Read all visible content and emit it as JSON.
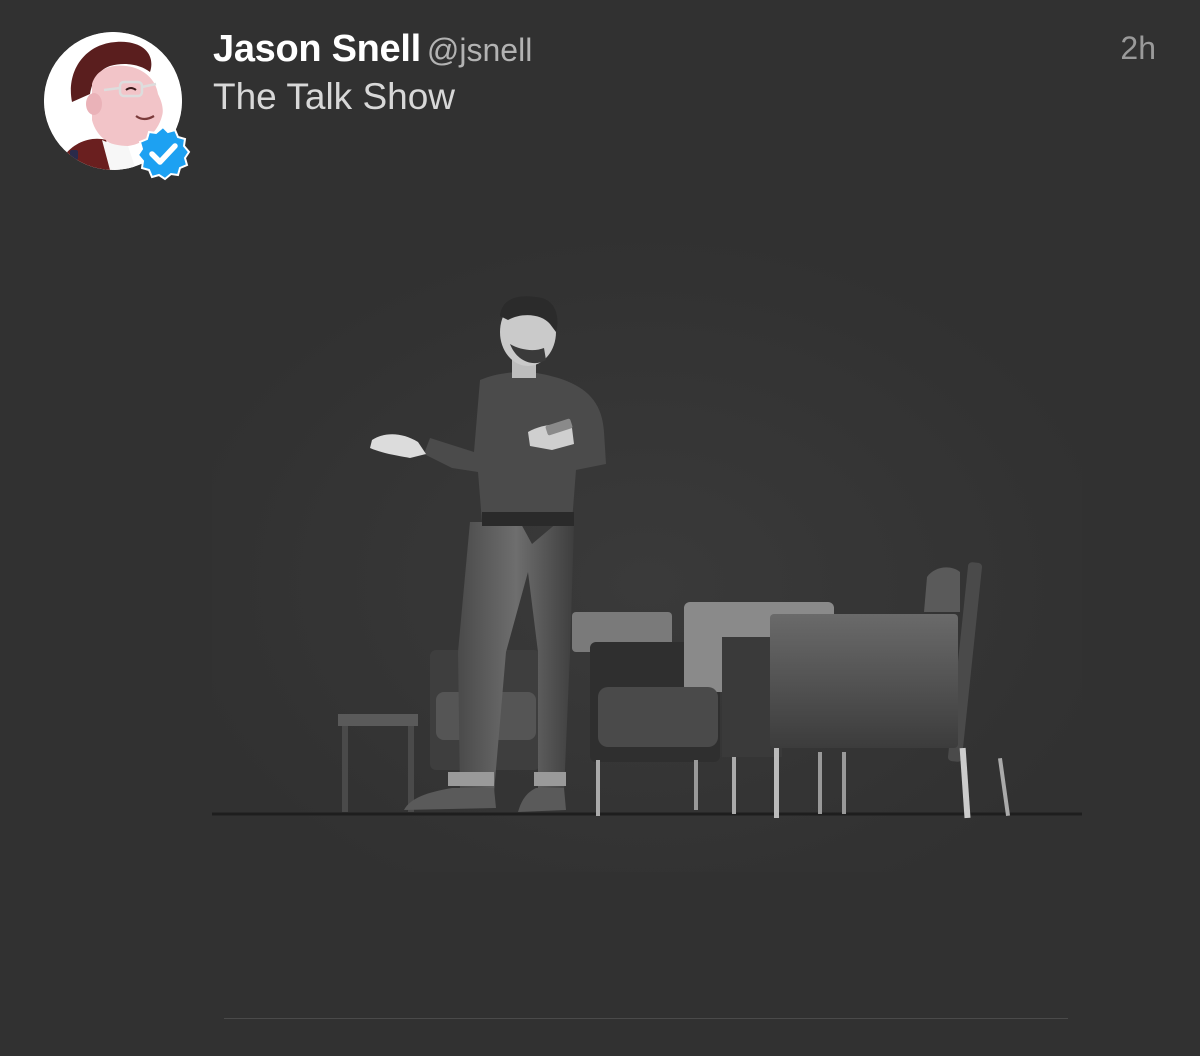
{
  "tweet": {
    "author": {
      "display_name": "Jason Snell",
      "handle": "@jsnell",
      "verified": true,
      "avatar_icon": "cartoon-avatar",
      "badge_icon": "verified-badge-icon"
    },
    "timestamp": "2h",
    "text": "The Talk Show",
    "media": {
      "type": "photo",
      "icon": "stage-photo"
    }
  },
  "colors": {
    "background": "#313131",
    "name": "#ffffff",
    "handle": "#b3b3b3",
    "timestamp": "#9a9a9a",
    "text": "#d8d8d8",
    "verified": "#1da1f2"
  }
}
